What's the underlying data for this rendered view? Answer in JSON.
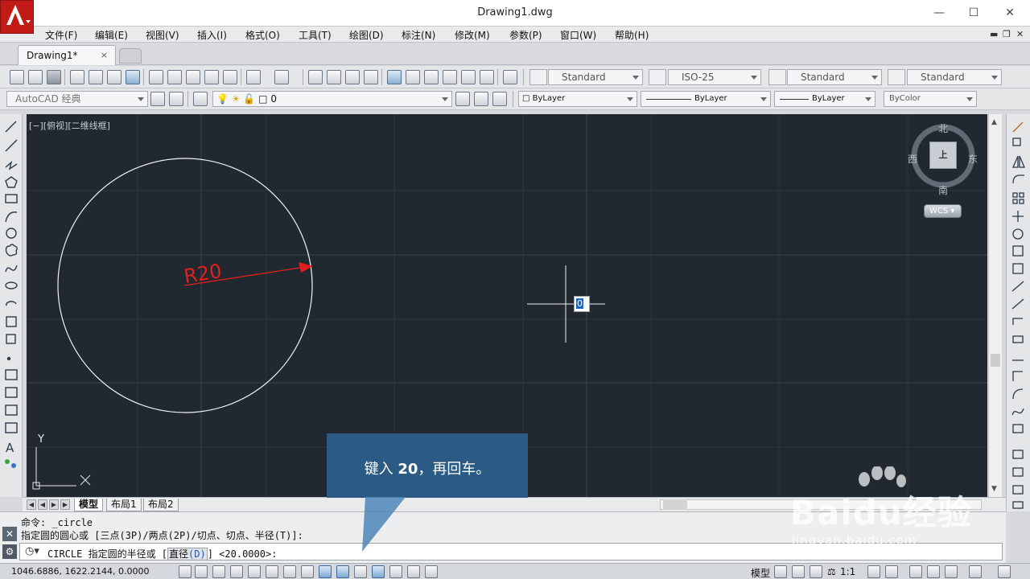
{
  "window": {
    "title": "Drawing1.dwg",
    "minimize": "—",
    "maximize": "☐",
    "close": "✕"
  },
  "menu": {
    "items": [
      "文件(F)",
      "编辑(E)",
      "视图(V)",
      "插入(I)",
      "格式(O)",
      "工具(T)",
      "绘图(D)",
      "标注(N)",
      "修改(M)",
      "参数(P)",
      "窗口(W)",
      "帮助(H)"
    ]
  },
  "tabs": {
    "active": "Drawing1*",
    "close": "×"
  },
  "toolbar1": {
    "text_style": "Standard",
    "dim_style": "ISO-25",
    "table_style": "Standard",
    "mleader_style": "Standard"
  },
  "toolbar2": {
    "workspace": "AutoCAD 经典",
    "layer": "0",
    "color": "ByLayer",
    "linetype": "ByLayer",
    "lineweight": "ByLayer",
    "plotstyle": "ByColor"
  },
  "canvas": {
    "viewport_label": "[−][俯视][二维线框]",
    "dimension_text": "R20",
    "cursor_input_value": "0",
    "ucs_y": "Y",
    "viewcube": {
      "north": "北",
      "south": "南",
      "east": "东",
      "west": "西",
      "face": "上",
      "wcs": "WCS"
    }
  },
  "layout_tabs": {
    "items": [
      "模型",
      "布局1",
      "布局2"
    ],
    "active_index": 0
  },
  "command": {
    "line1": "命令: _circle",
    "line2": "指定圆的圆心或 [三点(3P)/两点(2P)/切点、切点、半径(T)]:",
    "prompt_prefix": "CIRCLE 指定圆的半径或 [",
    "option_label": "直径",
    "option_key": "(D)",
    "prompt_suffix": "] <20.0000>:"
  },
  "status": {
    "coordinates": "1046.6886, 1622.2144, 0.0000",
    "model_label": "模型",
    "scale": "1:1"
  },
  "callout": {
    "prefix": "键入 ",
    "value": "20",
    "suffix": "，再回车。"
  },
  "watermark": {
    "brand": "Baidu经验",
    "url": "jingyan.baidu.com"
  },
  "colors": {
    "canvas": "#212830",
    "dimension": "#e0201c",
    "callout": "#2b5b84",
    "selection": "#1e64c8"
  }
}
